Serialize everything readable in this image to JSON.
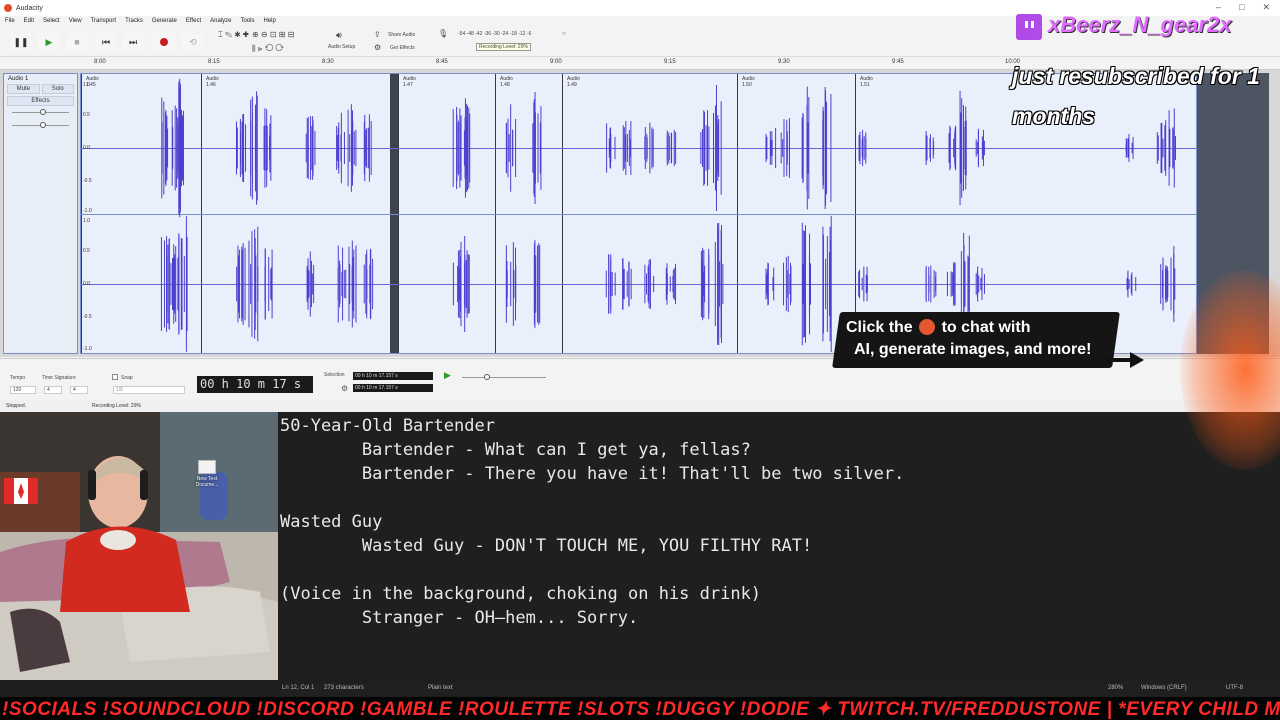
{
  "app": {
    "title": "Audacity",
    "menu": [
      "File",
      "Edit",
      "Select",
      "View",
      "Transport",
      "Tracks",
      "Generate",
      "Effect",
      "Analyze",
      "Tools",
      "Help"
    ],
    "share_audio": "Share Audio",
    "get_effects": "Get Effects",
    "audio_setup": "Audio Setup",
    "meter_scale": "-54 -48 -42 -36 -30 -24 -18 -12 -6",
    "recording_level_tooltip": "Recording Level: 29%",
    "ruler_ticks": [
      "8:00",
      "8:15",
      "8:30",
      "8:45",
      "9:00",
      "9:15",
      "9:30",
      "9:45",
      "10:00"
    ],
    "track": {
      "name": "Audio 1",
      "mute": "Mute",
      "solo": "Solo",
      "effects": "Effects",
      "clips": [
        "Audio 1.45",
        "Audio 1.46",
        "Audio 1.47",
        "Audio 1.48",
        "Audio 1.49",
        "Audio 1.50",
        "Audio 1.51"
      ],
      "amplitude_labels": [
        "1.0",
        "0.5",
        "0.0",
        "-0.5",
        "-1.0"
      ]
    },
    "selection_toolbar": {
      "tempo_label": "Tempo",
      "tempo_value": "120",
      "time_signature_label": "Time Signature",
      "time_sig_num": "4",
      "time_sig_den": "4",
      "snap_label": "Snap",
      "snap_value": "1/8",
      "time_display": "00 h 10 m 17 s",
      "selection_label": "Selection",
      "selection_start": "00 h 10 m 17.157 s",
      "selection_end": "00 h 10 m 17.157 s"
    },
    "status": {
      "left": "Stopped.",
      "right": "Recording Level: 29%"
    }
  },
  "overlays": {
    "twitch_user": "xBeerz_N_gear2x",
    "resub_line1": "just resubscribed for 1",
    "resub_line2": "months",
    "chat_popup_line1a": "Click the",
    "chat_popup_line1b": "to chat with",
    "chat_popup_line2": "AI, generate images, and more!"
  },
  "webcam": {
    "desktop_icon_label": "New Text Docume..."
  },
  "editor": {
    "lines": [
      "50-Year-Old Bartender",
      "        Bartender - What can I get ya, fellas?",
      "        Bartender - There you have it! That'll be two silver.",
      "",
      "Wasted Guy",
      "        Wasted Guy - DON'T TOUCH ME, YOU FILTHY RAT!",
      "",
      "(Voice in the background, choking on his drink)",
      "        Stranger - OH—hem... Sorry."
    ],
    "status": {
      "position": "Ln 12, Col 1",
      "chars": "273 characters",
      "mode": "Plain text",
      "zoom": "280%",
      "line_ending": "Windows (CRLF)",
      "encoding": "UTF-8"
    }
  },
  "ticker": {
    "text": "!SOCIALS !SOUNDCLOUD !DISCORD !GAMBLE !ROULETTE !SLOTS !DUGGY !DODIE ✦ TWITCH.TV/FREDDUSTONE | *EVERY CHILD MATTERS"
  },
  "colors": {
    "waveform": "#4a3fd0",
    "ticker": "#ff2a2a",
    "twitch": "#b04be8"
  }
}
